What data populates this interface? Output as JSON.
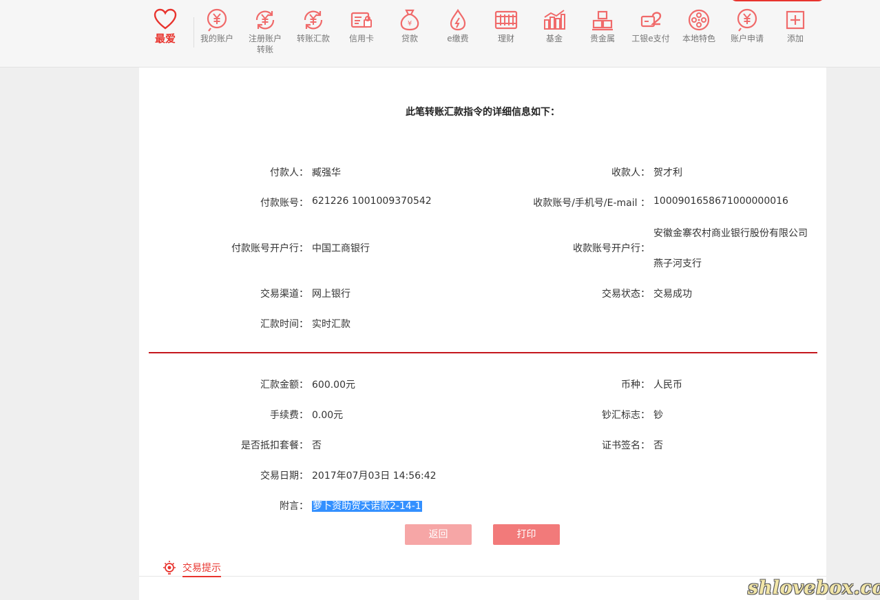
{
  "nav": {
    "favorite_label": "最爱",
    "items": [
      {
        "label": "我的账户",
        "icon": "account-coin-icon"
      },
      {
        "label": "注册账户转账",
        "icon": "transfer-cycle-icon"
      },
      {
        "label": "转账汇款",
        "icon": "remittance-cycle-icon"
      },
      {
        "label": "信用卡",
        "icon": "credit-card-icon"
      },
      {
        "label": "贷款",
        "icon": "loan-bag-icon"
      },
      {
        "label": "e缴费",
        "icon": "payment-drop-icon"
      },
      {
        "label": "理财",
        "icon": "abacus-icon"
      },
      {
        "label": "基金",
        "icon": "fund-chart-icon"
      },
      {
        "label": "贵金属",
        "icon": "gold-bars-icon"
      },
      {
        "label": "工银e支付",
        "icon": "e-pay-icon"
      },
      {
        "label": "本地特色",
        "icon": "film-reel-icon"
      },
      {
        "label": "账户申请",
        "icon": "apply-coin-icon"
      },
      {
        "label": "添加",
        "icon": "add-box-icon"
      }
    ],
    "register_transfer_line1": "注册账户",
    "register_transfer_line2": "转账"
  },
  "detail": {
    "heading": "此笔转账汇款指令的详细信息如下：",
    "payer_label": "付款人：",
    "payer": "臧强华",
    "payee_label": "收款人：",
    "payee": "贺才利",
    "payer_account_label": "付款账号：",
    "payer_account": "621226 1001009370542",
    "payee_account_label": "收款账号/手机号/E-mail ：",
    "payee_account": "1000901658671000000016",
    "payer_bank_label": "付款账号开户行：",
    "payer_bank": "中国工商银行",
    "payee_bank_label": "收款账号开户行：",
    "payee_bank_line1": "安徽金寨农村商业银行股份有限公司",
    "payee_bank_line2": "燕子河支行",
    "channel_label": "交易渠道：",
    "channel": "网上银行",
    "status_label": "交易状态：",
    "status": "交易成功",
    "time_label": "汇款时间：",
    "time": "实时汇款",
    "amount_label": "汇款金额：",
    "amount": "600.00元",
    "currency_label": "币种：",
    "currency": "人民币",
    "fee_label": "手续费：",
    "fee": "0.00元",
    "cash_flag_label": "钞汇标志：",
    "cash_flag": "钞",
    "package_label": "是否抵扣套餐：",
    "package": "否",
    "cert_label": "证书签名：",
    "cert": "否",
    "date_label": "交易日期：",
    "date": "2017年07月03日 14:56:42",
    "note_label": "附言：",
    "note": "萝卜资助贺天诺款2-14-1"
  },
  "buttons": {
    "back": "返回",
    "print": "打印"
  },
  "tips": {
    "label": "交易提示"
  },
  "watermark": "shlovebox.com",
  "colors": {
    "accent": "#e8342e",
    "divider": "#c4161c",
    "nav_icon": "#f06a6a"
  }
}
